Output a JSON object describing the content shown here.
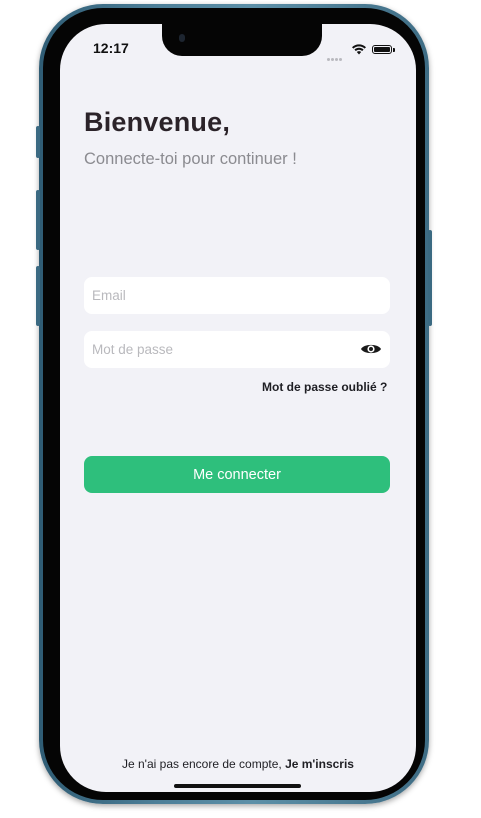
{
  "status_bar": {
    "time": "12:17",
    "wifi_icon": "wifi-icon",
    "battery_icon": "battery-icon"
  },
  "header": {
    "title": "Bienvenue,",
    "subtitle": "Connecte-toi pour continuer !"
  },
  "form": {
    "email": {
      "placeholder": "Email",
      "value": ""
    },
    "password": {
      "placeholder": "Mot de passe",
      "value": "",
      "toggle_icon": "eye-icon"
    },
    "forgot_password": "Mot de passe oublié ?",
    "submit_label": "Me connecter"
  },
  "footer": {
    "no_account_text": "Je n'ai pas encore de compte,",
    "signup_link": "Je m'inscris"
  },
  "colors": {
    "accent": "#2ebf7c",
    "background": "#f2f2f7",
    "title": "#2b2329",
    "subtitle": "#8b8b90",
    "device_frame": "#4d7f98"
  }
}
